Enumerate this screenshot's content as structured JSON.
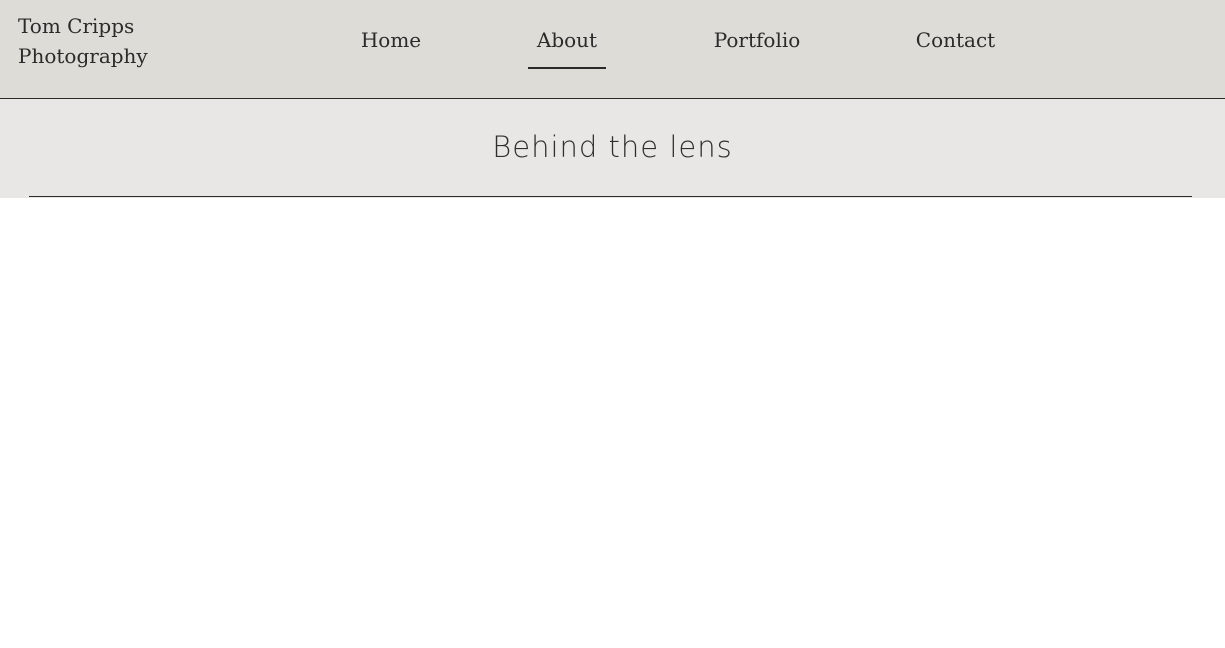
{
  "brand": {
    "line1": "Tom Cripps",
    "line2": "Photography"
  },
  "nav": {
    "items": [
      {
        "label": "Home"
      },
      {
        "label": "About"
      },
      {
        "label": "Portfolio"
      },
      {
        "label": "Contact"
      }
    ]
  },
  "hero": {
    "title": "Behind the lens"
  },
  "theme": {
    "header_background": "#dddcd7",
    "hero_background": "#e8e7e5",
    "text_color": "#2b2b2b",
    "accent_line_color": "#2a2a2a"
  }
}
